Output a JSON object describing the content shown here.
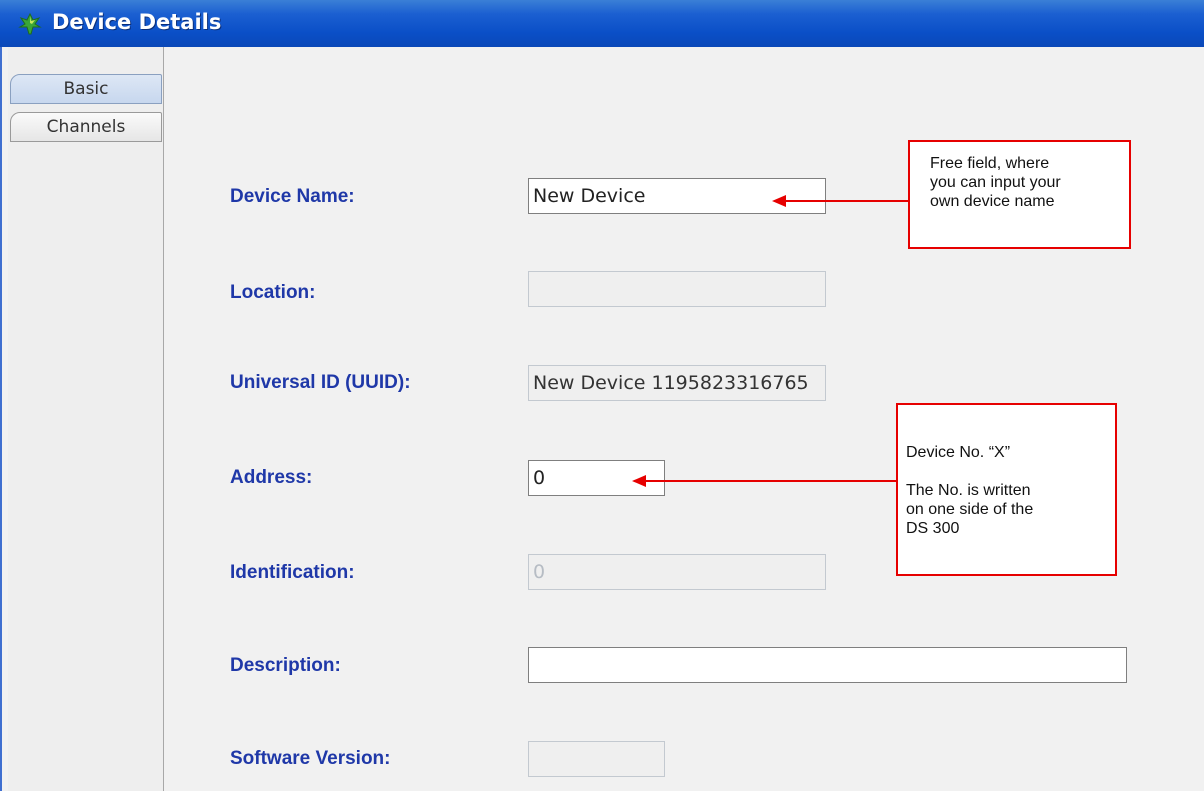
{
  "window": {
    "title": "Device Details"
  },
  "tabs": [
    {
      "label": "Basic",
      "selected": true
    },
    {
      "label": "Channels",
      "selected": false
    }
  ],
  "form": {
    "device_name": {
      "label": "Device Name:",
      "value": "New Device"
    },
    "location": {
      "label": "Location:",
      "value": ""
    },
    "uuid": {
      "label": "Universal ID (UUID):",
      "value": "New Device 1195823316765"
    },
    "address": {
      "label": "Address:",
      "value": "0"
    },
    "identification": {
      "label": "Identification:",
      "value": "0"
    },
    "description": {
      "label": "Description:",
      "value": ""
    },
    "software_version": {
      "label": "Software Version:",
      "value": ""
    }
  },
  "annotations": {
    "device_name_note": [
      "Free field, where",
      "you can input your",
      "own device name"
    ],
    "address_note": [
      "Device No. “X”",
      "",
      "The No. is written",
      "on one side of the",
      "DS 300"
    ]
  },
  "colors": {
    "titlebar": "#0a4fc7",
    "label": "#1f38a8",
    "callout_border": "#e60000"
  },
  "icons": {
    "app": "green-tree-icon"
  }
}
